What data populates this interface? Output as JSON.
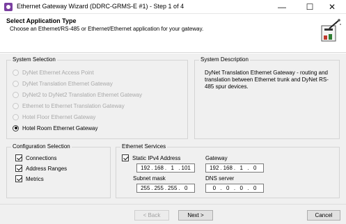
{
  "window": {
    "title": "Ethernet Gateway Wizard (DDRC-GRMS-E #1) - Step 1 of 4",
    "icons": {
      "app": "app-icon",
      "minimize": "minimize-icon",
      "maximize": "maximize-icon",
      "close": "close-icon"
    },
    "buttons": {
      "minimize": "—",
      "maximize": "☐",
      "close": "✕"
    }
  },
  "header": {
    "title": "Select Application Type",
    "subtitle": "Choose an Ethernet/RS-485 or Ethernet/Ethernet application for your gateway.",
    "icon": "wizard-icon"
  },
  "system_selection": {
    "title": "System Selection",
    "options": [
      {
        "label": "DyNet Ethernet Access Point",
        "enabled": false,
        "selected": false
      },
      {
        "label": "DyNet Translation Ethernet Gateway",
        "enabled": false,
        "selected": false
      },
      {
        "label": "DyNet2 to DyNet2 Translation Ethernet Gateway",
        "enabled": false,
        "selected": false
      },
      {
        "label": "Ethernet to Ethernet Translation Gateway",
        "enabled": false,
        "selected": false
      },
      {
        "label": "Hotel Floor Ethernet Gateway",
        "enabled": false,
        "selected": false
      },
      {
        "label": "Hotel Room Ethernet Gateway",
        "enabled": true,
        "selected": true
      }
    ]
  },
  "system_description": {
    "title": "System Description",
    "text": "DyNet Translation Ethernet Gateway - routing and translation between Ethernet trunk and DyNet RS-485 spur devices."
  },
  "configuration_selection": {
    "title": "Configuration Selection",
    "items": [
      {
        "label": "Connections",
        "checked": true
      },
      {
        "label": "Address Ranges",
        "checked": true
      },
      {
        "label": "Metrics",
        "checked": true
      }
    ]
  },
  "ethernet_services": {
    "title": "Ethernet Services",
    "static_ipv4_label": "Static IPv4 Address",
    "static_ipv4_checked": true,
    "ip_address": [
      "192",
      "168",
      "1",
      "101"
    ],
    "subnet_label": "Subnet mask",
    "subnet_mask": [
      "255",
      "255",
      "255",
      "0"
    ],
    "gateway_label": "Gateway",
    "gateway": [
      "192",
      "168",
      "1",
      "0"
    ],
    "dns_label": "DNS server",
    "dns_server": [
      "0",
      "0",
      "0",
      "0"
    ]
  },
  "footer": {
    "back_label": "< Back",
    "next_label": "Next >",
    "cancel_label": "Cancel"
  }
}
